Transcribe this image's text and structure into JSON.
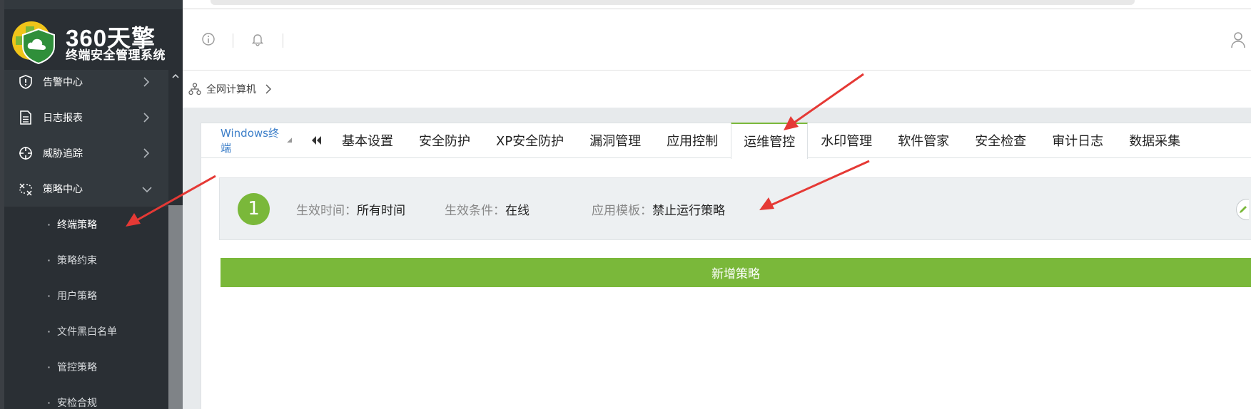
{
  "logo": {
    "title": "360天擎",
    "subtitle": "终端安全管理系统"
  },
  "sidebar": {
    "items": [
      {
        "label": "告警中心",
        "icon": "shield-alert-icon",
        "expanded": false
      },
      {
        "label": "日志报表",
        "icon": "document-icon",
        "expanded": false
      },
      {
        "label": "威胁追踪",
        "icon": "crosshair-icon",
        "expanded": false
      },
      {
        "label": "策略中心",
        "icon": "policy-icon",
        "expanded": true
      }
    ],
    "subitems": [
      {
        "label": "终端策略",
        "active": true
      },
      {
        "label": "策略约束",
        "active": false
      },
      {
        "label": "用户策略",
        "active": false
      },
      {
        "label": "文件黑白名单",
        "active": false
      },
      {
        "label": "管控策略",
        "active": false
      },
      {
        "label": "安检合规",
        "active": false
      }
    ]
  },
  "header": {
    "icons": [
      "info-icon",
      "bell-icon",
      "user-icon"
    ]
  },
  "breadcrumb": {
    "label": "全网计算机",
    "icon": "network-icon"
  },
  "tabs": {
    "os_select": "Windows终端",
    "items": [
      "基本设置",
      "安全防护",
      "XP安全防护",
      "漏洞管理",
      "应用控制",
      "运维管控",
      "水印管理",
      "软件管家",
      "安全检查",
      "审计日志",
      "数据采集"
    ],
    "active": "运维管控"
  },
  "policy": {
    "number": "1",
    "effective_time_label": "生效时间：",
    "effective_time_value": "所有时间",
    "condition_label": "生效条件：",
    "condition_value": "在线",
    "template_label": "应用模板：",
    "template_value": "禁止运行策略"
  },
  "add_button": "新增策略",
  "colors": {
    "accent_green": "#7ab83a",
    "sidebar_bg": "#33393e",
    "link_blue": "#3d7fc9",
    "annotation_red": "#e53935"
  }
}
